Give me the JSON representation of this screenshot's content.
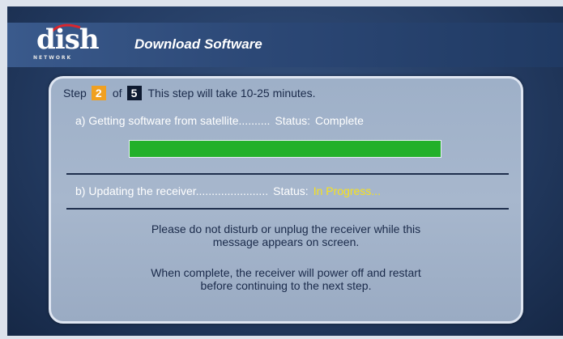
{
  "header": {
    "logo_word": "dish",
    "logo_sub": "NETWORK",
    "title": "Download Software"
  },
  "step": {
    "prefix": "Step",
    "current": "2",
    "of_label": "of",
    "total": "5",
    "duration_text": "This step will take 10-25 minutes."
  },
  "task_a": {
    "label": "a) Getting software from satellite..........",
    "status_label": "Status:",
    "status_value": "Complete",
    "progress_fraction": 1.0
  },
  "task_b": {
    "label": "b) Updating the receiver.......................",
    "status_label": "Status:",
    "status_value": "In Progress..."
  },
  "messages": {
    "warning_line1": "Please do not disturb or unplug the receiver while this",
    "warning_line2": "message appears on screen.",
    "complete_line1": "When complete, the receiver will power off and restart",
    "complete_line2": "before continuing to the next step."
  },
  "colors": {
    "accent_orange": "#f0a020",
    "progress_green": "#22b02a",
    "in_progress_yellow": "#f8e21c"
  }
}
